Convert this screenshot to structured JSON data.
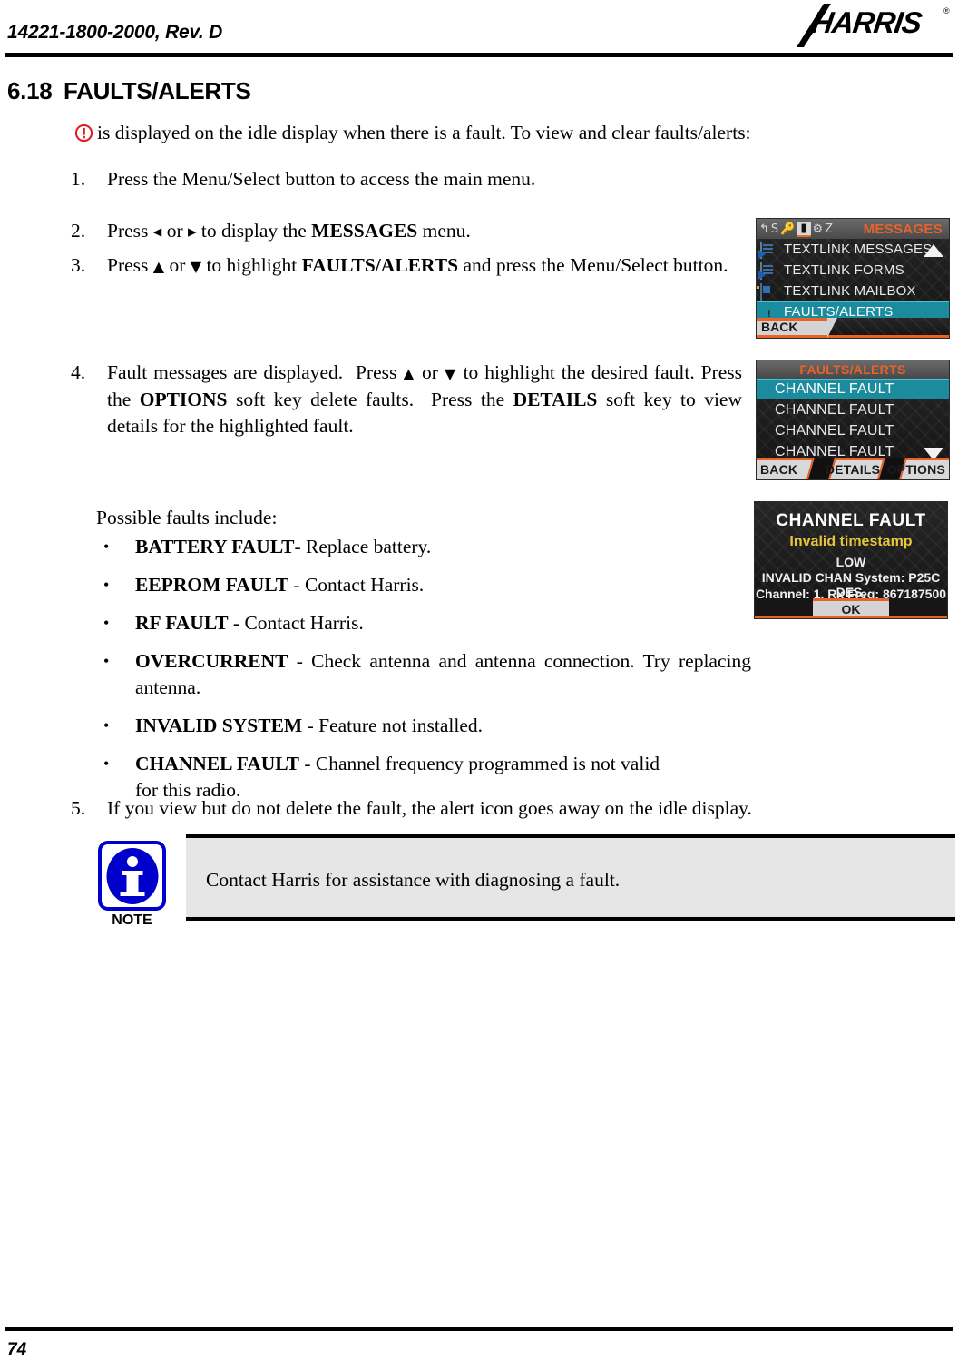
{
  "header": {
    "document_id": "14221-1800-2000, Rev. D",
    "logo_text": "HARRIS",
    "logo_trademark": "®"
  },
  "section": {
    "number": "6.18",
    "title": "FAULTS/ALERTS"
  },
  "intro": {
    "icon": "alert-exclamation-icon",
    "text": "is displayed on the idle display when there is a fault. To view and clear faults/alerts:"
  },
  "steps": [
    {
      "marker": "1.",
      "html": "Press the Menu/Select button to access the main menu."
    },
    {
      "marker": "2.",
      "html": "Press <span class=\"arrow-glyph arrow-lr\">◂</span> or <span class=\"arrow-glyph arrow-lr\">▸</span> to display the <b>MESSAGES</b> menu."
    },
    {
      "marker": "3.",
      "html": "Press <span class=\"arrow-glyph\">▲</span> or <span class=\"arrow-glyph\">▼</span> to highlight <b>FAULTS/ALERTS</b> and press the Menu/Select button."
    },
    {
      "marker": "4.",
      "html": "Fault messages are displayed.&nbsp; Press <span class=\"arrow-glyph\">▲</span> or <span class=\"arrow-glyph\">▼</span> to highlight the desired fault. Press the <b>OPTIONS</b> soft key delete faults.&nbsp; Press the <b>DETAILS</b> soft key to view details for the highlighted fault."
    },
    {
      "marker": "5.",
      "html": "If you view but do not delete the fault, the alert icon goes away on the idle display."
    }
  ],
  "possible_faults_label": "Possible faults include:",
  "faults": [
    {
      "name": "BATTERY FAULT",
      "sep": "-",
      "desc": "Replace battery."
    },
    {
      "name": "EEPROM FAULT",
      "sep": " -",
      "desc": "Contact Harris."
    },
    {
      "name": "RF FAULT",
      "sep": " -",
      "desc": "Contact Harris."
    },
    {
      "name": "OVERCURRENT",
      "sep": " -",
      "desc": "Check antenna and antenna connection. Try replacing antenna."
    },
    {
      "name": "INVALID SYSTEM",
      "sep": " -",
      "desc": "Feature not installed."
    },
    {
      "name": "CHANNEL FAULT",
      "sep": " -",
      "desc": "Channel frequency programmed is not valid for this radio."
    }
  ],
  "note": {
    "label": "NOTE",
    "icon": "info-icon",
    "text": "Contact Harris for assistance with diagnosing a fault."
  },
  "footer": {
    "page_number": "74"
  },
  "radio_screens": {
    "messages": {
      "title": "MESSAGES",
      "status_icons": [
        "call-icon",
        "scan-icon",
        "key-icon",
        "message-icon",
        "gear-icon",
        "zone-icon"
      ],
      "items": [
        {
          "label": "TEXTLINK MESSAGES",
          "icon": "textlink-messages-icon",
          "selected": false
        },
        {
          "label": "TEXTLINK FORMS",
          "icon": "textlink-forms-icon",
          "selected": false
        },
        {
          "label": "TEXTLINK MAILBOX",
          "icon": "textlink-mailbox-icon",
          "selected": false
        },
        {
          "label": "FAULTS/ALERTS",
          "icon": "warning-triangle-icon",
          "selected": true
        }
      ],
      "scroll_indicator": "up",
      "softkeys": {
        "left": "BACK"
      }
    },
    "faults_list": {
      "title": "FAULTS/ALERTS",
      "items": [
        {
          "label": "CHANNEL FAULT",
          "selected": true
        },
        {
          "label": "CHANNEL FAULT",
          "selected": false
        },
        {
          "label": "CHANNEL FAULT",
          "selected": false
        },
        {
          "label": "CHANNEL FAULT",
          "selected": false
        }
      ],
      "scroll_indicator": "down",
      "softkeys": {
        "left": "BACK",
        "middle": "DETAILS",
        "right": "OPTIONS"
      }
    },
    "fault_detail": {
      "title": "CHANNEL FAULT",
      "subtitle": "Invalid timestamp",
      "severity": "LOW",
      "line1": "INVALID CHAN System: P25C DES,",
      "line2": "Channel: 1, Rx Freq: 867187500",
      "softkeys": {
        "center": "OK"
      }
    }
  },
  "colors": {
    "accent_orange": "#e8622a",
    "selection_teal": "#1a8c9e",
    "warning_yellow": "#f2c230",
    "note_blue": "#0000CC",
    "alert_red": "#E02020"
  }
}
